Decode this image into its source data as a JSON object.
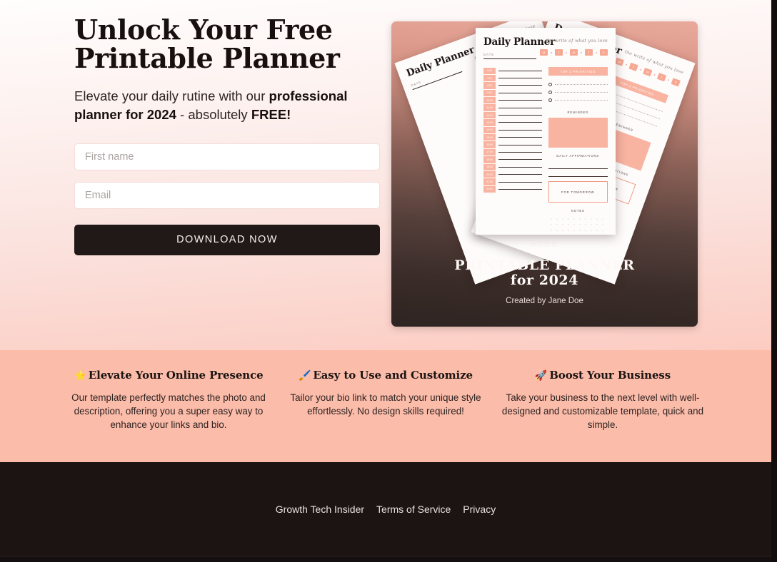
{
  "hero": {
    "title": "Unlock Your Free\nPrintable Planner",
    "subtitle_part1": "Elevate your daily rutine with our ",
    "subtitle_bold1": "professional planner for 2024",
    "subtitle_part2": " - absolutely ",
    "subtitle_bold2": "FREE!",
    "form": {
      "first_name_placeholder": "First name",
      "first_name_value": "",
      "email_placeholder": "Email",
      "email_value": "",
      "cta_label": "DOWNLOAD NOW"
    }
  },
  "card": {
    "caption_free": "FREE",
    "caption_main": "PRINTABLE PLANNER\nfor 2024",
    "caption_author": "Created by Jane Doe",
    "sheet": {
      "title": "Daily Planner",
      "script": "the write of what you love",
      "date_label": "DATE",
      "days": [
        "M",
        "T",
        "W",
        "T",
        "F"
      ],
      "priorities_label": "TOP 3 PRIORITIES",
      "reminder_label": "REMINDER",
      "affirmations_label": "DAILY AFFIRMATIONS",
      "tomorrow_label": "FOR TOMORROW",
      "notes_label": "NOTES",
      "times": [
        "6:00",
        "7:00",
        "8:00",
        "9:00",
        "10:00",
        "11:00",
        "12:00",
        "13:00",
        "14:00",
        "15:00",
        "16:00",
        "17:00",
        "18:00",
        "19:00",
        "20:00",
        "21:00",
        "22:00"
      ]
    }
  },
  "features": [
    {
      "emoji": "⭐",
      "emoji_name": "star-icon",
      "heading": "Elevate Your Online Presence",
      "body": "Our template perfectly matches the photo and description, offering you a super easy way to enhance your links and bio."
    },
    {
      "emoji": "🖌️",
      "emoji_name": "paintbrush-icon",
      "heading": "Easy to Use and Customize",
      "body": "Tailor your bio link to match your unique style effortlessly. No design skills required!"
    },
    {
      "emoji": "🚀",
      "emoji_name": "rocket-icon",
      "heading": "Boost Your Business",
      "body": "Take your business to the next level with well-designed and customizable template, quick and simple."
    }
  ],
  "footer": {
    "links": [
      "Growth Tech Insider",
      "Terms of Service",
      "Privacy"
    ]
  },
  "colors": {
    "accent_pink": "#fcbcaa",
    "planner_pink": "#f9b3a1",
    "dark": "#1b1412",
    "button": "#211917"
  }
}
